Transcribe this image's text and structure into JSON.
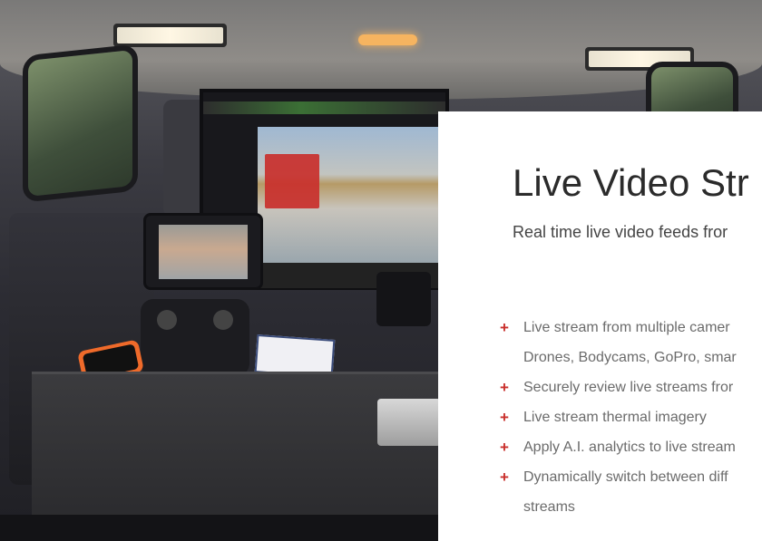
{
  "slide": {
    "title": "Live Video Str",
    "subtitle": "Real time live video feeds fror",
    "bullet_marker": "+",
    "bullets": [
      {
        "lines": [
          "Live stream from multiple camer",
          "Drones, Bodycams, GoPro, smar"
        ]
      },
      {
        "lines": [
          "Securely review live streams fror"
        ]
      },
      {
        "lines": [
          "Live stream thermal imagery"
        ]
      },
      {
        "lines": [
          "Apply A.I. analytics to live stream"
        ]
      },
      {
        "lines": [
          "Dynamically switch between diff",
          "streams"
        ]
      }
    ]
  },
  "colors": {
    "accent": "#c9302c",
    "panel_bg": "#ffffff",
    "title_text": "#2b2b2b",
    "body_text": "#6b6b6b"
  }
}
